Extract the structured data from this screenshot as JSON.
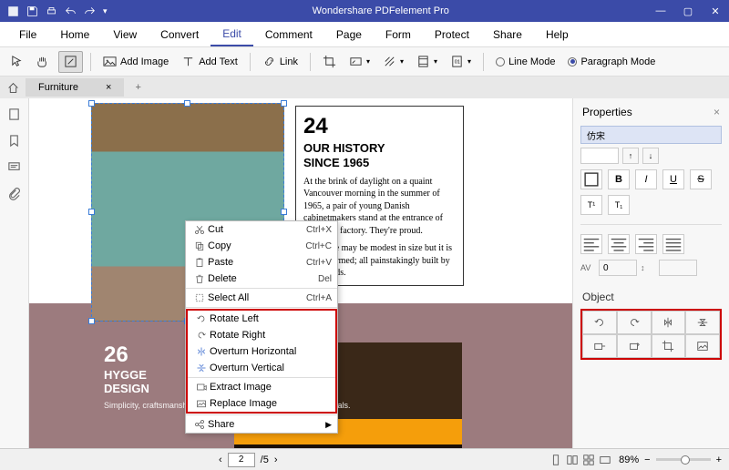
{
  "titlebar": {
    "title": "Wondershare PDFelement Pro"
  },
  "menu": [
    "File",
    "Home",
    "View",
    "Convert",
    "Edit",
    "Comment",
    "Page",
    "Form",
    "Protect",
    "Share",
    "Help"
  ],
  "menu_active": "Edit",
  "toolbar": {
    "add_image": "Add Image",
    "add_text": "Add Text",
    "link": "Link",
    "line_mode": "Line Mode",
    "paragraph_mode": "Paragraph Mode"
  },
  "tab": {
    "name": "Furniture"
  },
  "doc": {
    "num1": "24",
    "hdr1a": "OUR HISTORY",
    "hdr1b": "SINCE 1965",
    "p1": "At the brink of daylight on a quaint Vancouver morning in the summer of 1965, a pair of young Danish cabinetmakers stand at the entrance of their new factory. They're proud.",
    "p2": "The place may be modest in size but it is newly formed; all painstakingly built by their hands.",
    "num2": "26",
    "hdr2a": "HYGGE",
    "hdr2b": "DESIGN",
    "p3": "Simplicity, craftsmanship, elegant functionality and quality materials."
  },
  "ctx": {
    "cut": "Cut",
    "cut_sc": "Ctrl+X",
    "copy": "Copy",
    "copy_sc": "Ctrl+C",
    "paste": "Paste",
    "paste_sc": "Ctrl+V",
    "delete": "Delete",
    "delete_sc": "Del",
    "select_all": "Select All",
    "select_all_sc": "Ctrl+A",
    "rotate_left": "Rotate Left",
    "rotate_right": "Rotate Right",
    "over_h": "Overturn Horizontal",
    "over_v": "Overturn Vertical",
    "extract": "Extract Image",
    "replace": "Replace Image",
    "share": "Share"
  },
  "props": {
    "title": "Properties",
    "font": "仿宋",
    "av": "0",
    "object": "Object"
  },
  "status": {
    "page": "2",
    "total": "/5",
    "zoom": "89%"
  }
}
